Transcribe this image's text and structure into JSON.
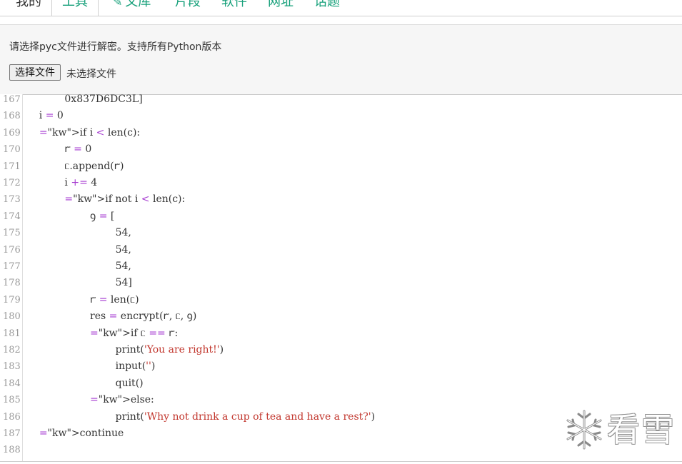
{
  "nav": {
    "tabs": [
      {
        "label": "我的"
      },
      {
        "label": "工具"
      },
      {
        "label": "文库",
        "icon": "pen-icon"
      },
      {
        "label": "片段"
      },
      {
        "label": "软件"
      },
      {
        "label": "网址"
      },
      {
        "label": "话题"
      }
    ]
  },
  "panel": {
    "description": "请选择pyc文件进行解密。支持所有Python版本",
    "file_button": "选择文件",
    "file_status": "未选择文件"
  },
  "code": {
    "lines": [
      {
        "n": "167",
        "t": "            0x837D6DC3L]"
      },
      {
        "n": "168",
        "t": "    i = 0"
      },
      {
        "n": "169",
        "t": "    if i < len(c):"
      },
      {
        "n": "170",
        "t": "            ꭈ = 0"
      },
      {
        "n": "171",
        "t": "            ᥴ.append(ꭈ)"
      },
      {
        "n": "172",
        "t": "            i += 4"
      },
      {
        "n": "173",
        "t": "            if not i < len(c):"
      },
      {
        "n": "174",
        "t": "                    ꝯ = ["
      },
      {
        "n": "175",
        "t": "                            54,"
      },
      {
        "n": "176",
        "t": "                            54,"
      },
      {
        "n": "177",
        "t": "                            54,"
      },
      {
        "n": "178",
        "t": "                            54]"
      },
      {
        "n": "179",
        "t": "                    ꭈ = len(ᥴ)"
      },
      {
        "n": "180",
        "t": "                    res = encrypt(ꭈ, ᥴ, ꝯ)"
      },
      {
        "n": "181",
        "t": "                    if ᥴ == ꭈ:"
      },
      {
        "n": "182",
        "t": "                            print('You are right!')"
      },
      {
        "n": "183",
        "t": "                            input('')"
      },
      {
        "n": "184",
        "t": "                            quit()"
      },
      {
        "n": "185",
        "t": "                    else:"
      },
      {
        "n": "186",
        "t": "                            print('Why not drink a cup of tea and have a rest?')"
      },
      {
        "n": "187",
        "t": "    continue"
      },
      {
        "n": "188",
        "t": ""
      }
    ]
  },
  "watermark": {
    "text": "看雪",
    "icon": "snowflake-icon"
  },
  "colors": {
    "accent": "#16a07a",
    "keyword": "#7a2bb0",
    "string": "#c2372e"
  }
}
